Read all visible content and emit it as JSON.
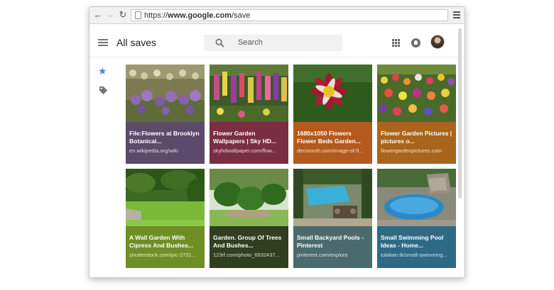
{
  "browser": {
    "url_prefix": "https://",
    "url_host": "www.google.com",
    "url_path": "/save",
    "back_icon": "arrow-left-icon",
    "forward_icon": "arrow-right-icon",
    "reload_icon": "reload-icon",
    "menu_icon": "hamburger-menu-icon"
  },
  "header": {
    "title": "All saves",
    "search_placeholder": "Search",
    "apps_icon": "apps-grid-icon",
    "notifications_icon": "bell-icon",
    "avatar_icon": "user-avatar"
  },
  "sidebar": {
    "items": [
      {
        "icon": "star-icon",
        "active": true,
        "color": "#4285f4"
      },
      {
        "icon": "tag-icon",
        "active": false,
        "color": "#757575"
      }
    ]
  },
  "cards": [
    {
      "title": "File:Flowers at Brooklyn Botanical...",
      "source": "en.wikipedia.org/wiki",
      "color": "#5b4a6a"
    },
    {
      "title": "Flower Garden Wallpapers | Sky HD...",
      "source": "skyhdwallpaper.com/flow...",
      "color": "#7a2e45"
    },
    {
      "title": "1680x1050 Flowers Flower Beds Garden...",
      "source": "decoronth.com/image-of-fl...",
      "color": "#b35a1e"
    },
    {
      "title": "Flower Garden Pictures | pictures o...",
      "source": "flowergardenpictures.com",
      "color": "#a8651b"
    },
    {
      "title": "A Wall Garden With Cipress And Bushes...",
      "source": "shutterstock.com/pic-2721...",
      "color": "#6f8f24"
    },
    {
      "title": "Garden. Group Of Trees And Bushes...",
      "source": "123rf.com/photo_6932437...",
      "color": "#2f3f1f"
    },
    {
      "title": "Small Backyard Pools - Pinterest",
      "source": "pinterest.com/explore",
      "color": "#4a6a6e"
    },
    {
      "title": "Small Swimming Pool Ideas - Home...",
      "source": "tulakan.tk/small-swimming...",
      "color": "#2e6a86"
    }
  ]
}
